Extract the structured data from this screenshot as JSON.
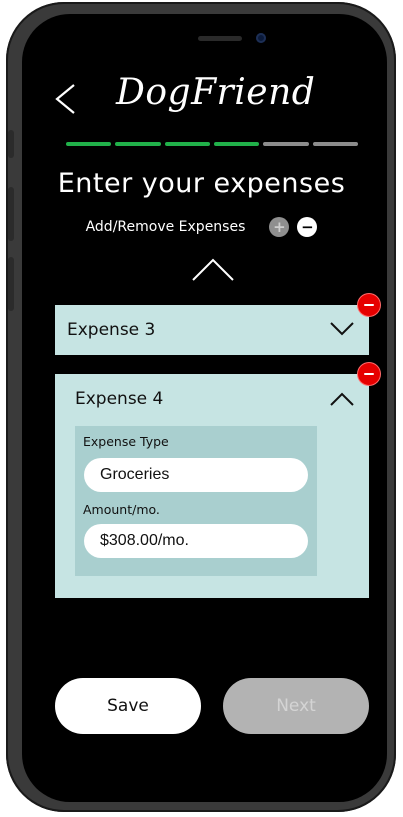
{
  "app": {
    "title": "DogFriend"
  },
  "progress": {
    "total_steps": 6,
    "completed_steps": 4,
    "colors": {
      "done": "#21b14a",
      "todo": "#8c8c8c"
    }
  },
  "page": {
    "title": "Enter your expenses",
    "subtitle": "Add/Remove Expenses",
    "add_symbol": "+",
    "remove_symbol": "−"
  },
  "expenses": [
    {
      "label": "Expense 3",
      "expanded": false
    },
    {
      "label": "Expense 4",
      "expanded": true,
      "type_label": "Expense Type",
      "type_value": "Groceries",
      "amount_label": "Amount/mo.",
      "amount_value": "$308.00/mo."
    }
  ],
  "actions": {
    "save_label": "Save",
    "next_label": "Next"
  },
  "colors": {
    "card": "#c6e4e3",
    "panel": "#a9cfcf",
    "remove": "#e60000",
    "disabled": "#b3b3b3"
  },
  "icons": {
    "back": "chevron-left-icon",
    "collapse_all": "chevron-up-icon",
    "expand": "chevron-down-icon",
    "collapse": "chevron-up-icon",
    "remove": "minus-circle-icon",
    "add": "plus-circle-icon"
  }
}
